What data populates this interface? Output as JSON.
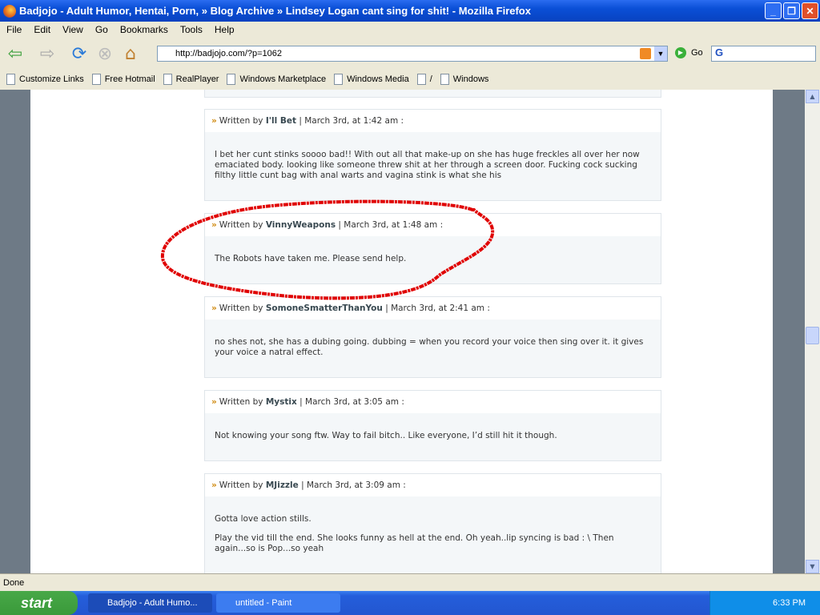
{
  "window": {
    "title": "Badjojo - Adult Humor, Hentai, Porn, » Blog Archive » Lindsey Logan cant sing for shit! - Mozilla Firefox"
  },
  "menu": [
    "File",
    "Edit",
    "View",
    "Go",
    "Bookmarks",
    "Tools",
    "Help"
  ],
  "navbar": {
    "url": "http://badjojo.com/?p=1062",
    "go_label": "Go",
    "search_value": "G"
  },
  "bookmarks": [
    "Customize Links",
    "Free Hotmail",
    "RealPlayer",
    "Windows Marketplace",
    "Windows Media",
    "/",
    "Windows"
  ],
  "comments": [
    {
      "prefix": "Written by",
      "author": "I'll Bet",
      "date": "| March 3rd, at 1:42 am :",
      "paragraphs": [
        "I bet her cunt stinks soooo bad!! With out all that make-up on she has huge freckles all over her now emaciated body. looking like someone threw shit at her through a screen door. Fucking cock sucking filthy little cunt bag with anal warts and vagina stink is what she his"
      ]
    },
    {
      "prefix": "Written by",
      "author": "VinnyWeapons",
      "date": "| March 3rd, at 1:48 am :",
      "paragraphs": [
        "The Robots have taken me. Please send help."
      ],
      "highlighted": true
    },
    {
      "prefix": "Written by",
      "author": "SomoneSmatterThanYou",
      "date": "| March 3rd, at 2:41 am :",
      "paragraphs": [
        "no shes not, she has a dubing going. dubbing = when you record your voice then sing over it. it gives your voice a natral effect."
      ]
    },
    {
      "prefix": "Written by",
      "author": "Mystix",
      "date": "| March 3rd, at 3:05 am :",
      "paragraphs": [
        "Not knowing your song ftw. Way to fail bitch.. Like everyone, I’d still hit it though."
      ]
    },
    {
      "prefix": "Written by",
      "author": "MJizzle",
      "date": "| March 3rd, at 3:09 am :",
      "paragraphs": [
        "Gotta love action stills.",
        "Play the vid till the end. She looks funny as hell at the end. Oh yeah..lip syncing is bad : \\ Then again...so is Pop...so yeah"
      ]
    }
  ],
  "status": "Done",
  "taskbar": {
    "start": "start",
    "tasks": [
      "Badjojo - Adult Humo...",
      "untitled - Paint"
    ],
    "clock": "6:33 PM"
  },
  "colors": {
    "highlight_circle": "#e00000",
    "comment_arrow": "#d08a10",
    "titlebar": "#0a4fd6"
  }
}
